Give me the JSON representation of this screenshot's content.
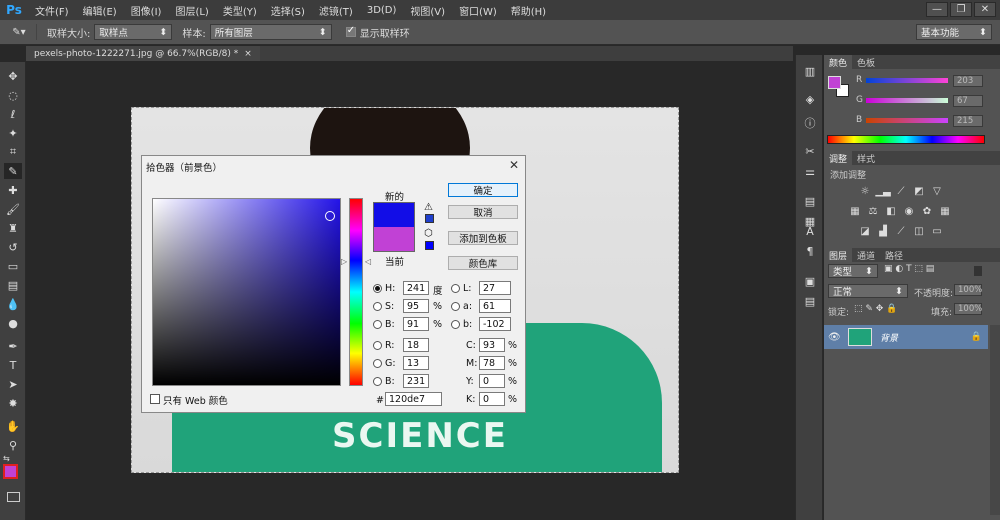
{
  "app": {
    "logo": "Ps"
  },
  "menu": [
    "文件(F)",
    "编辑(E)",
    "图像(I)",
    "图层(L)",
    "类型(Y)",
    "选择(S)",
    "滤镜(T)",
    "3D(D)",
    "视图(V)",
    "窗口(W)",
    "帮助(H)"
  ],
  "window_buttons": {
    "minimize": "—",
    "restore": "❐",
    "close": "✕"
  },
  "options": {
    "sample_size_label": "取样大小:",
    "sample_size_value": "取样点",
    "sample_label": "样本:",
    "sample_value": "所有图层",
    "show_ring_label": "显示取样环",
    "show_ring_checked": true,
    "workspace": "基本功能"
  },
  "document_tab": {
    "title": "pexels-photo-1222271.jpg @ 66.7%(RGB/8) *",
    "close": "×"
  },
  "photo": {
    "text": "SCIENCE"
  },
  "picker": {
    "title": "拾色器（前景色）",
    "new_label": "新的",
    "current_label": "当前",
    "new_color": "#120de7",
    "current_color": "#c141d5",
    "buttons": {
      "ok": "确定",
      "cancel": "取消",
      "add_swatch": "添加到色板",
      "libraries": "颜色库"
    },
    "hsb": {
      "H": "241",
      "S": "95",
      "B": "91",
      "H_unit": "度",
      "S_unit": "%",
      "B_unit": "%"
    },
    "rgb": {
      "R": "18",
      "G": "13",
      "B": "231"
    },
    "lab": {
      "L": "27",
      "a": "61",
      "b": "-102"
    },
    "cmyk": {
      "C": "93",
      "M": "78",
      "Y": "0",
      "K": "0"
    },
    "hex_label": "#",
    "hex": "120de7",
    "web_only_label": "只有 Web 颜色",
    "field_labels": {
      "H": "H:",
      "S": "S:",
      "Bv": "B:",
      "R": "R:",
      "G": "G:",
      "Bb": "B:",
      "L": "L:",
      "a": "a:",
      "b": "b:",
      "C": "C:",
      "M": "M:",
      "Y": "Y:",
      "K": "K:"
    },
    "percent": "%"
  },
  "color_panel": {
    "tabs": [
      "颜色",
      "色板"
    ],
    "R_label": "R",
    "G_label": "G",
    "B_label": "B",
    "R": "203",
    "G": "67",
    "B": "215",
    "fg_color": "#c141d5"
  },
  "adjust_panel": {
    "tabs": [
      "调整",
      "样式"
    ],
    "hint": "添加调整"
  },
  "layers_panel": {
    "tabs": [
      "图层",
      "通道",
      "路径"
    ],
    "filter_label": "类型",
    "blend_mode": "正常",
    "opacity_label": "不透明度:",
    "opacity_value": "100%",
    "lock_label": "锁定:",
    "fill_label": "填充:",
    "fill_value": "100%",
    "layer_name": "背景"
  }
}
